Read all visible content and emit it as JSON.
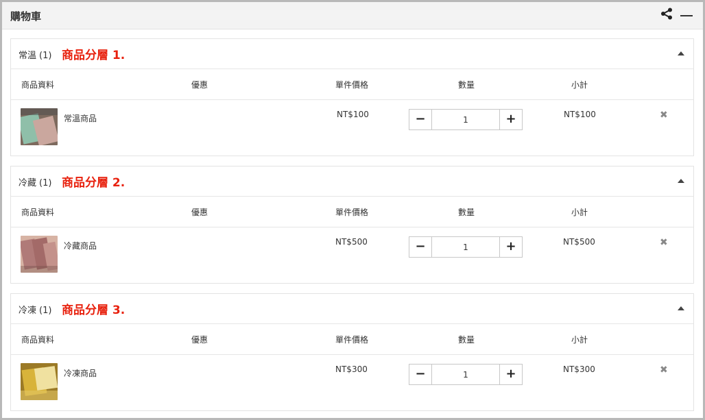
{
  "header": {
    "title": "購物車",
    "share_icon": "share-icon",
    "minimize_icon": "minimize-icon"
  },
  "columns": {
    "product_info": "商品資料",
    "discount": "優惠",
    "unit_price": "單件價格",
    "quantity": "數量",
    "subtotal": "小計"
  },
  "groups": [
    {
      "name": "常溫",
      "count": "(1)",
      "tier_label": "商品分層 1.",
      "item": {
        "name": "常溫商品",
        "price": "NT$100",
        "quantity": "1",
        "subtotal": "NT$100",
        "thumb_colors": [
          "#8fbfa9",
          "#caa79e",
          "#4a4a4a"
        ]
      }
    },
    {
      "name": "冷藏",
      "count": "(1)",
      "tier_label": "商品分層 2.",
      "item": {
        "name": "冷藏商品",
        "price": "NT$500",
        "quantity": "1",
        "subtotal": "NT$500",
        "thumb_colors": [
          "#b07a78",
          "#d7b3a4",
          "#6e4a44"
        ]
      }
    },
    {
      "name": "冷凍",
      "count": "(1)",
      "tier_label": "商品分層 3.",
      "item": {
        "name": "冷凍商品",
        "price": "NT$300",
        "quantity": "1",
        "subtotal": "NT$300",
        "thumb_colors": [
          "#d8b33a",
          "#f0e1a0",
          "#9b7a26"
        ]
      }
    }
  ],
  "colors": {
    "tier_label": "#e8210e",
    "header_bg": "#f3f3f3",
    "border": "#e3e3e3"
  }
}
